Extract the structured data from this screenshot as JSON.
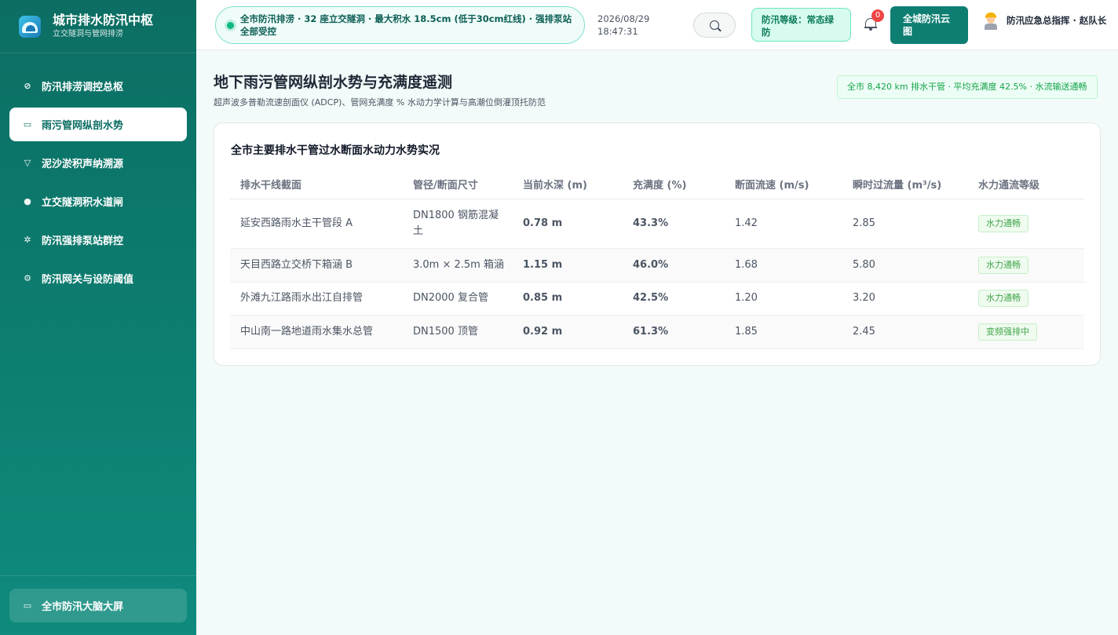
{
  "sidebar": {
    "brand_title": "城市排水防汛中枢",
    "brand_sub": "立交隧洞与管网排涝",
    "items": [
      {
        "label": "防汛排涝调控总枢",
        "icon": "compass-icon",
        "active": false
      },
      {
        "label": "雨污管网纵剖水势",
        "icon": "monitor-icon",
        "active": true
      },
      {
        "label": "泥沙淤积声纳溯源",
        "icon": "filter-icon",
        "active": false
      },
      {
        "label": "立交隧洞积水道闸",
        "icon": "alert-icon",
        "active": false
      },
      {
        "label": "防汛强排泵站群控",
        "icon": "gear-icon",
        "active": false
      },
      {
        "label": "防汛网关与设防阈值",
        "icon": "settings-icon",
        "active": false
      }
    ],
    "bottom_label": "全市防汛大脑大屏"
  },
  "header": {
    "alert_text": "全市防汛排涝 · 32 座立交隧洞 · 最大积水 18.5cm (低于30cm红线) · 强排泵站全部受控",
    "date": "2026/08/29",
    "time": "18:47:31",
    "level_badge": "防汛等级：常态绿防",
    "notification_count": "0",
    "cloud_button": "全城防汛云图",
    "user_name": "防汛应急总指挥 · 赵队长"
  },
  "main": {
    "title": "地下雨污管网纵剖水势与充满度遥测",
    "subtitle": "超声波多普勒流速剖面仪 (ADCP)、管网充满度 % 水动力学计算与高潮位倒灌顶托防范",
    "summary": "全市 8,420 km 排水干管 · 平均充满度 42.5% · 水流输送通畅",
    "card_title": "全市主要排水干管过水断面水动力水势实况",
    "columns": [
      "排水干线截面",
      "管径/断面尺寸",
      "当前水深 (m)",
      "充满度 (%)",
      "断面流速 (m/s)",
      "瞬时过流量 (m³/s)",
      "水力通流等级"
    ],
    "rows": [
      {
        "name": "延安西路雨水主干管段 A",
        "size": "DN1800 钢筋混凝土",
        "depth": "0.78 m",
        "fullness": "43.3%",
        "velocity": "1.42",
        "flow": "2.85",
        "level": "水力通畅"
      },
      {
        "name": "天目西路立交桥下箱涵 B",
        "size": "3.0m × 2.5m 箱涵",
        "depth": "1.15 m",
        "fullness": "46.0%",
        "velocity": "1.68",
        "flow": "5.80",
        "level": "水力通畅"
      },
      {
        "name": "外滩九江路雨水出江自排管",
        "size": "DN2000 复合管",
        "depth": "0.85 m",
        "fullness": "42.5%",
        "velocity": "1.20",
        "flow": "3.20",
        "level": "水力通畅"
      },
      {
        "name": "中山南一路地道雨水集水总管",
        "size": "DN1500 顶管",
        "depth": "0.92 m",
        "fullness": "61.3%",
        "velocity": "1.85",
        "flow": "2.45",
        "level": "变频强排中"
      }
    ]
  }
}
